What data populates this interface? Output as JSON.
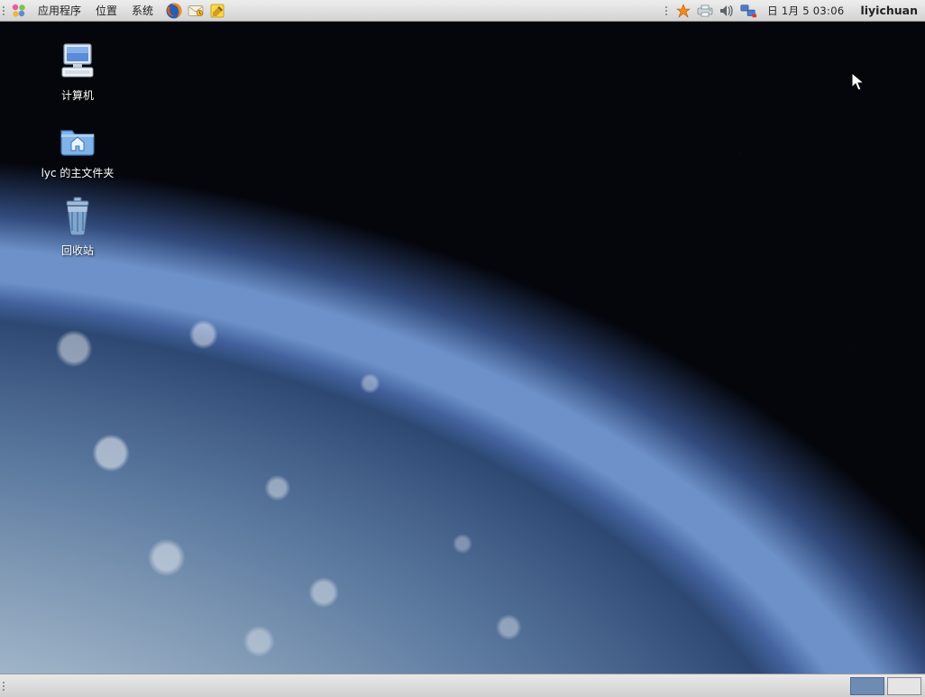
{
  "panel": {
    "menus": {
      "applications": "应用程序",
      "places": "位置",
      "system": "系统"
    },
    "launchers": {
      "firefox": "firefox-icon",
      "mail": "mail-icon",
      "notes": "notes-icon"
    },
    "tray": {
      "update": "update-icon",
      "print": "printer-icon",
      "volume": "volume-icon",
      "network": "network-icon"
    },
    "clock": "日 1月  5 03:06",
    "user": "liyichuan"
  },
  "desktop": {
    "computer": "计算机",
    "home": "lyc 的主文件夹",
    "trash": "回收站"
  },
  "workspace": {
    "count": 2,
    "active": 0
  }
}
